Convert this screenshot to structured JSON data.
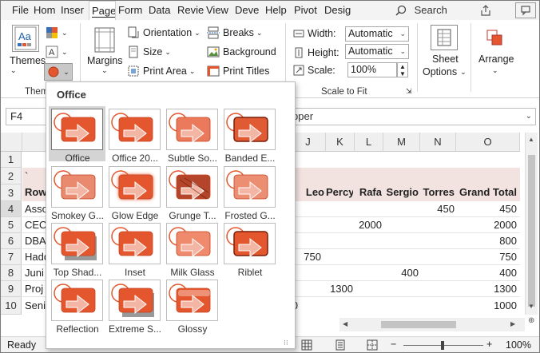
{
  "menu": {
    "tabs": [
      "File",
      "Hom",
      "Inser",
      "Page",
      "Form",
      "Data",
      "Revie",
      "View",
      "Deve",
      "Help",
      "Pivot",
      "Desig"
    ],
    "active_tab": "Page",
    "search_label": "Search"
  },
  "ribbon": {
    "themes_label": "Themes",
    "themes_group_label": "Them",
    "margins_label": "Margins",
    "orientation_label": "Orientation",
    "size_label": "Size",
    "print_area_label": "Print Area",
    "breaks_label": "Breaks",
    "background_label": "Background",
    "print_titles_label": "Print Titles",
    "width_label": "Width:",
    "width_value": "Automatic",
    "height_label": "Height:",
    "height_value": "Automatic",
    "scale_label": "Scale:",
    "scale_value": "100%",
    "scale_group_label": "Scale to Fit",
    "sheet_options_label1": "Sheet",
    "sheet_options_label2": "Options",
    "arrange_label": "Arrange"
  },
  "formula_bar": {
    "name_box": "F4",
    "formula_text": "pper"
  },
  "columns": [
    "J",
    "K",
    "L",
    "M",
    "N",
    "O"
  ],
  "rows": [
    "1",
    "2",
    "3",
    "4",
    "5",
    "6",
    "7",
    "8",
    "9",
    "10"
  ],
  "left_cells": {
    "r2": "`",
    "r3": "Row",
    "r4": "Asso",
    "r5": "CEO",
    "r6": "DBA",
    "r7": "Hadd",
    "r8": "Juni",
    "r9": "Proj",
    "r10": "Seni"
  },
  "header_row": [
    "Leo",
    "Percy",
    "Rafa",
    "Sergio",
    "Torres",
    "Grand Total"
  ],
  "values": {
    "r4_N": "450",
    "r4_O": "450",
    "r5_L": "2000",
    "r5_O": "2000",
    "r6_O": "800",
    "r7_J": "750",
    "r7_O": "750",
    "r8_M": "400",
    "r8_O": "400",
    "r9_K": "1300",
    "r9_O": "1300",
    "r10_partial": "0",
    "r10_O": "1000"
  },
  "status": {
    "ready": "Ready",
    "zoom": "100%"
  },
  "popup": {
    "title": "Office",
    "themes": [
      "Office",
      "Office 20...",
      "Subtle So...",
      "Banded E...",
      "Smokey G...",
      "Glow Edge",
      "Grunge T...",
      "Frosted G...",
      "Top Shad...",
      "Inset",
      "Milk Glass",
      "Riblet",
      "Reflection",
      "Extreme S...",
      "Glossy"
    ]
  },
  "colors": {
    "accent_orange": "#e4572e",
    "band_pink": "#f2e2e0",
    "ribbon_bg": "#f3f3f3"
  }
}
